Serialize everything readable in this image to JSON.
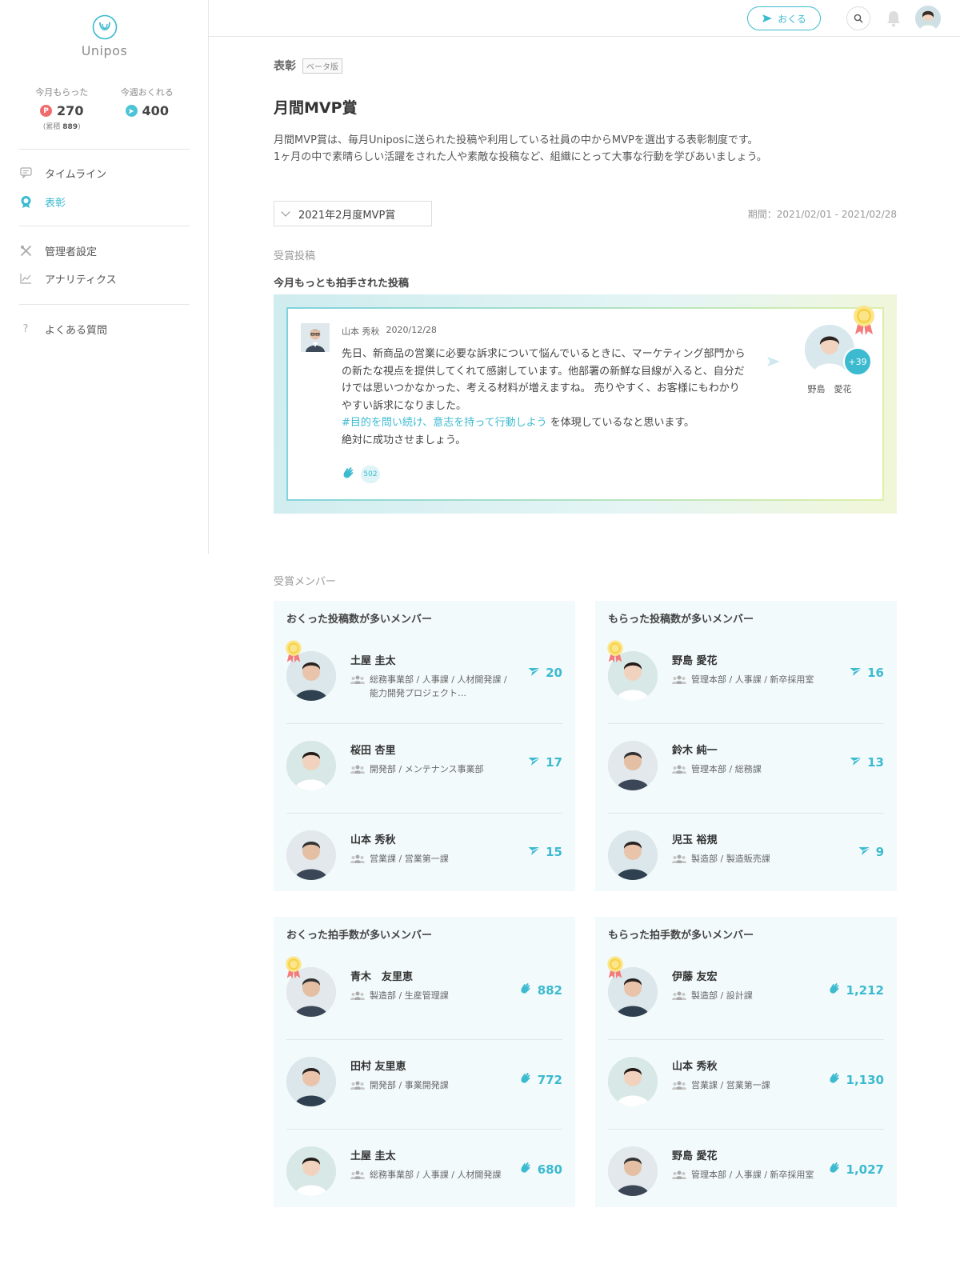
{
  "sidebar": {
    "brand": "Unipos",
    "stats": {
      "received_label": "今月もらった",
      "received_value": "270",
      "received_badge": "P",
      "total_label": "累積",
      "total_value": "889",
      "sendable_label": "今週おくれる",
      "sendable_value": "400"
    },
    "nav": [
      {
        "label": "タイムライン",
        "icon": "chat-icon",
        "active": false
      },
      {
        "label": "表彰",
        "icon": "award-icon",
        "active": true
      },
      {
        "label": "管理者設定",
        "icon": "tools-icon",
        "active": false
      },
      {
        "label": "アナリティクス",
        "icon": "chart-icon",
        "active": false
      },
      {
        "label": "よくある質問",
        "icon": "question-icon",
        "active": false
      }
    ]
  },
  "header": {
    "send_label": "おくる"
  },
  "main": {
    "breadcrumb": "表彰",
    "beta": "ベータ版",
    "title": "月間MVP賞",
    "description_1": "月間MVP賞は、毎月Uniposに送られた投稿や利用している社員の中からMVPを選出する表彰制度です。",
    "description_2": "1ヶ月の中で素晴らしい活躍をされた人や素敵な投稿など、組織にとって大事な行動を学びあいましょう。",
    "period_select": "2021年2月度MVP賞",
    "period": "期間：2021/02/01 - 2021/02/28",
    "awarded_posts_label": "受賞投稿",
    "top_post_title": "今月もっとも拍手された投稿",
    "awarded_members_label": "受賞メンバー"
  },
  "post": {
    "author": "山本 秀秋",
    "date": "2020/12/28",
    "body": "先日、新商品の営業に必要な訴求について悩んでいるときに、マーケティング部門からの新たな視点を提供してくれて感謝しています。他部署の新鮮な目線が入ると、自分だけでは思いつかなかった、考える材料が増えますね。 売りやすく、お客様にもわかりやすい訴求になりました。",
    "hashtag": "#目的を問い続け、意志を持って行動しよう",
    "hashtag_suffix": " を体現しているなと思います。",
    "closing": "絶対に成功させましょう。",
    "clap_count": "502",
    "receiver_name": "野島　愛花",
    "receiver_extra": "+39"
  },
  "cards": [
    {
      "title": "おくった投稿数が多いメンバー",
      "score_icon": "send-icon",
      "rows": [
        {
          "name": "土屋 圭太",
          "dept": "総務事業部 / 人事課 / 人材開発課 / 能力開発プロジェクト…",
          "score": "20",
          "medal": true
        },
        {
          "name": "桜田 杏里",
          "dept": "開発部 / メンテナンス事業部",
          "score": "17",
          "medal": false
        },
        {
          "name": "山本 秀秋",
          "dept": "営業課 / 営業第一課",
          "score": "15",
          "medal": false
        }
      ]
    },
    {
      "title": "もらった投稿数が多いメンバー",
      "score_icon": "send-icon",
      "rows": [
        {
          "name": "野島 愛花",
          "dept": "管理本部 / 人事課 / 新卒採用室",
          "score": "16",
          "medal": true
        },
        {
          "name": "鈴木 純一",
          "dept": "管理本部 / 総務課",
          "score": "13",
          "medal": false
        },
        {
          "name": "児玉 裕規",
          "dept": "製造部 / 製造販売課",
          "score": "9",
          "medal": false
        }
      ]
    },
    {
      "title": "おくった拍手数が多いメンバー",
      "score_icon": "clap-icon",
      "rows": [
        {
          "name": "青木　友里恵",
          "dept": "製造部 / 生産管理課",
          "score": "882",
          "medal": true
        },
        {
          "name": "田村 友里恵",
          "dept": "開発部 / 事業開発課",
          "score": "772",
          "medal": false
        },
        {
          "name": "土屋 圭太",
          "dept": "総務事業部 / 人事課 / 人材開発課",
          "score": "680",
          "medal": false
        }
      ]
    },
    {
      "title": "もらった拍手数が多いメンバー",
      "score_icon": "clap-icon",
      "rows": [
        {
          "name": "伊藤 友宏",
          "dept": "製造部 / 設計課",
          "score": "1,212",
          "medal": true
        },
        {
          "name": "山本 秀秋",
          "dept": "営業課 / 営業第一課",
          "score": "1,130",
          "medal": false
        },
        {
          "name": "野島 愛花",
          "dept": "管理本部 / 人事課 / 新卒採用室",
          "score": "1,027",
          "medal": false
        }
      ]
    }
  ],
  "colors": {
    "accent": "#3cbad0",
    "points": "#f06b6b",
    "card_bg": "#f3fafb"
  }
}
